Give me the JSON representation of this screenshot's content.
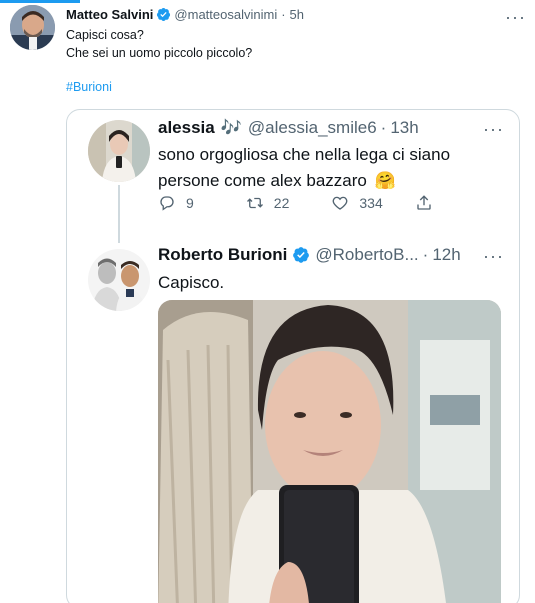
{
  "tweet": {
    "author_name": "Matteo Salvini",
    "handle": "@matteosalvinimi",
    "separator": "·",
    "time": "5h",
    "text_line1": "Capisci cosa?",
    "text_line2": "Che sei un uomo piccolo piccolo?",
    "hashtag": "#Burioni"
  },
  "quoted": {
    "reply": {
      "author_name": "alessia",
      "name_emoji": "🎶",
      "handle": "@alessia_smile6",
      "separator": "·",
      "time": "13h",
      "text_line1": "sono orgogliosa che nella lega ci siano",
      "text_line2": "persone come alex bazzaro",
      "emoji": "🤗",
      "reply_count": "9",
      "retweet_count": "22",
      "like_count": "334"
    },
    "original": {
      "author_name": "Roberto Burioni",
      "handle": "@RobertoB...",
      "separator": "·",
      "time": "12h",
      "text": "Capisco."
    }
  },
  "colors": {
    "accent": "#1d9bf0",
    "verified": "#1d9bf0",
    "text": "#0f1419",
    "muted": "#536471",
    "border": "#cfd9de"
  },
  "icons": [
    "verified-badge-icon",
    "more-options-icon",
    "reply-icon",
    "retweet-icon",
    "like-icon",
    "share-icon"
  ]
}
